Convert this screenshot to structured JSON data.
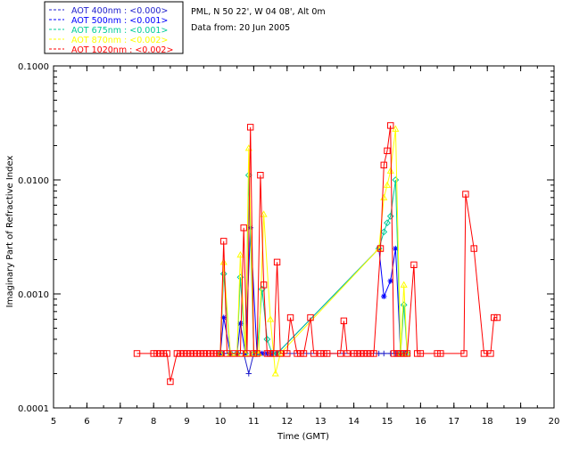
{
  "chart_data": {
    "type": "line",
    "xlabel": "Time (GMT)",
    "ylabel": "Imaginary Part of Refractive Index",
    "xlim": [
      5,
      20
    ],
    "ylim": [
      0.0001,
      0.1
    ],
    "yscale": "log",
    "xticks": [
      "5",
      "6",
      "7",
      "8",
      "9",
      "10",
      "11",
      "12",
      "13",
      "14",
      "15",
      "16",
      "17",
      "18",
      "19",
      "20"
    ],
    "yticks": [
      {
        "v": 0.0001,
        "label": "0.0001"
      },
      {
        "v": 0.001,
        "label": "0.0010"
      },
      {
        "v": 0.01,
        "label": "0.0100"
      },
      {
        "v": 0.1,
        "label": "0.1000"
      }
    ],
    "info_lines": [
      "PML, N 50 22', W 04 08', Alt 0m",
      "Data from: 20 Jun 2005"
    ],
    "legend_position": "top-left, outside plot",
    "series": [
      {
        "name": "AOT  400nm : <0.000>",
        "color": "#2222cc",
        "marker": "plus",
        "x": [
          10.0,
          10.1,
          10.3,
          10.5,
          10.7,
          10.85,
          11.0,
          11.1,
          11.25,
          11.4,
          11.55,
          11.7,
          14.75,
          14.9,
          15.1,
          15.25,
          15.4,
          15.55
        ],
        "y": [
          0.0003,
          0.0003,
          0.0003,
          0.0003,
          0.0003,
          0.0002,
          0.0003,
          0.0003,
          0.0003,
          0.0003,
          0.0003,
          0.0003,
          0.0003,
          0.0003,
          0.0003,
          0.0003,
          0.0003,
          0.0003
        ]
      },
      {
        "name": "AOT  500nm : <0.001>",
        "color": "#0000ff",
        "marker": "star",
        "x": [
          10.0,
          10.1,
          10.3,
          10.5,
          10.6,
          10.75,
          10.9,
          11.1,
          11.25,
          11.4,
          11.55,
          11.7,
          14.75,
          14.9,
          15.1,
          15.25,
          15.4,
          15.55
        ],
        "y": [
          0.0003,
          0.00062,
          0.0003,
          0.0003,
          0.00055,
          0.0003,
          0.0038,
          0.0003,
          0.0003,
          0.0003,
          0.0003,
          0.0003,
          0.0025,
          0.00095,
          0.0013,
          0.0025,
          0.0003,
          0.0003
        ]
      },
      {
        "name": "AOT  675nm : <0.001>",
        "color": "#00cc99",
        "marker": "diamond",
        "x": [
          10.0,
          10.1,
          10.3,
          10.5,
          10.6,
          10.75,
          10.85,
          11.0,
          11.1,
          11.25,
          11.4,
          11.55,
          11.7,
          14.75,
          14.9,
          15.0,
          15.1,
          15.25,
          15.4,
          15.5,
          15.6
        ],
        "y": [
          0.0003,
          0.0015,
          0.0003,
          0.0003,
          0.0014,
          0.0003,
          0.011,
          0.0003,
          0.0003,
          0.0011,
          0.0004,
          0.0003,
          0.0003,
          0.0025,
          0.0035,
          0.0042,
          0.0048,
          0.01,
          0.0003,
          0.0008,
          0.0003
        ]
      },
      {
        "name": "AOT  870nm : <0.002>",
        "color": "#ffff00",
        "marker": "triangle",
        "x": [
          10.0,
          10.1,
          10.3,
          10.5,
          10.6,
          10.75,
          10.85,
          11.0,
          11.15,
          11.3,
          11.5,
          11.65,
          11.8,
          14.75,
          14.9,
          15.0,
          15.1,
          15.25,
          15.4,
          15.5,
          15.6
        ],
        "y": [
          0.0003,
          0.0019,
          0.0003,
          0.0003,
          0.0022,
          0.0003,
          0.019,
          0.0003,
          0.0003,
          0.005,
          0.0006,
          0.0002,
          0.0003,
          0.0025,
          0.007,
          0.009,
          0.012,
          0.028,
          0.0003,
          0.0012,
          0.0003
        ]
      },
      {
        "name": "AOT 1020nm : <0.002>",
        "color": "#ff0000",
        "marker": "square",
        "x": [
          7.5,
          8.0,
          8.1,
          8.2,
          8.3,
          8.4,
          8.5,
          8.7,
          8.8,
          8.9,
          9.0,
          9.1,
          9.2,
          9.3,
          9.4,
          9.5,
          9.6,
          9.7,
          9.8,
          9.9,
          10.0,
          10.1,
          10.2,
          10.4,
          10.6,
          10.7,
          10.8,
          10.9,
          11.0,
          11.1,
          11.2,
          11.3,
          11.4,
          11.5,
          11.6,
          11.7,
          11.8,
          12.0,
          12.1,
          12.3,
          12.4,
          12.5,
          12.7,
          12.8,
          13.0,
          13.1,
          13.2,
          13.6,
          13.7,
          13.8,
          14.0,
          14.1,
          14.2,
          14.3,
          14.4,
          14.5,
          14.6,
          14.8,
          14.9,
          15.0,
          15.1,
          15.2,
          15.3,
          15.4,
          15.5,
          15.6,
          15.8,
          15.9,
          16.0,
          16.5,
          16.6,
          17.3,
          17.35,
          17.6,
          17.9,
          18.1,
          18.2,
          18.3
        ],
        "y": [
          0.0003,
          0.0003,
          0.0003,
          0.0003,
          0.0003,
          0.0003,
          0.00017,
          0.0003,
          0.0003,
          0.0003,
          0.0003,
          0.0003,
          0.0003,
          0.0003,
          0.0003,
          0.0003,
          0.0003,
          0.0003,
          0.0003,
          0.0003,
          0.0003,
          0.0029,
          0.0003,
          0.0003,
          0.0003,
          0.0038,
          0.0003,
          0.029,
          0.0003,
          0.0003,
          0.011,
          0.0012,
          0.0003,
          0.0003,
          0.0003,
          0.0019,
          0.0003,
          0.0003,
          0.00062,
          0.0003,
          0.0003,
          0.0003,
          0.00062,
          0.0003,
          0.0003,
          0.0003,
          0.0003,
          0.0003,
          0.00058,
          0.0003,
          0.0003,
          0.0003,
          0.0003,
          0.0003,
          0.0003,
          0.0003,
          0.0003,
          0.0025,
          0.0135,
          0.018,
          0.03,
          0.0003,
          0.0003,
          0.0003,
          0.0003,
          0.0003,
          0.0018,
          0.0003,
          0.0003,
          0.0003,
          0.0003,
          0.0003,
          0.0075,
          0.0025,
          0.0003,
          0.0003,
          0.00062,
          0.00062
        ]
      }
    ]
  }
}
